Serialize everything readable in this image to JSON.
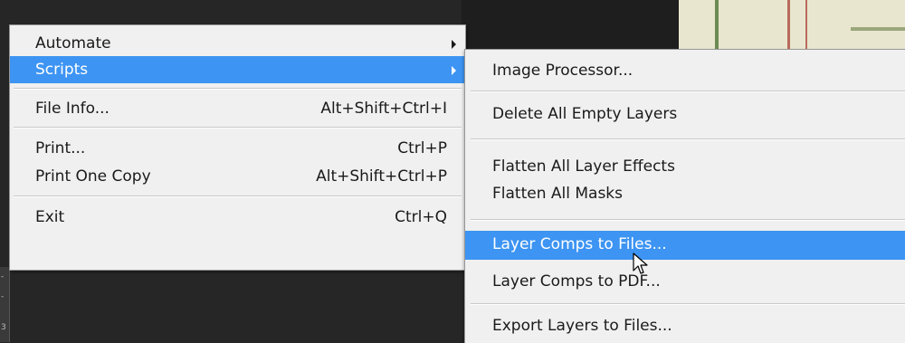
{
  "main_menu": {
    "items": [
      {
        "label": "Automate",
        "shortcut": "",
        "has_submenu": true
      },
      {
        "label": "Scripts",
        "shortcut": "",
        "has_submenu": true,
        "highlighted": true
      },
      {
        "label": "File Info...",
        "shortcut": "Alt+Shift+Ctrl+I"
      },
      {
        "label": "Print...",
        "shortcut": "Ctrl+P"
      },
      {
        "label": "Print One Copy",
        "shortcut": "Alt+Shift+Ctrl+P"
      },
      {
        "label": "Exit",
        "shortcut": "Ctrl+Q"
      }
    ]
  },
  "scripts_submenu": {
    "items": [
      {
        "label": "Image Processor..."
      },
      {
        "label": "Delete All Empty Layers"
      },
      {
        "label": "Flatten All Layer Effects"
      },
      {
        "label": "Flatten All Masks"
      },
      {
        "label": "Layer Comps to Files...",
        "highlighted": true
      },
      {
        "label": "Layer Comps to PDF..."
      },
      {
        "label": "Export Layers to Files..."
      }
    ]
  },
  "ruler": {
    "marks": [
      "-",
      "-",
      "3"
    ]
  },
  "colors": {
    "highlight": "#3d94f2",
    "menu_bg": "#f0f0f0",
    "app_bg": "#262626"
  }
}
